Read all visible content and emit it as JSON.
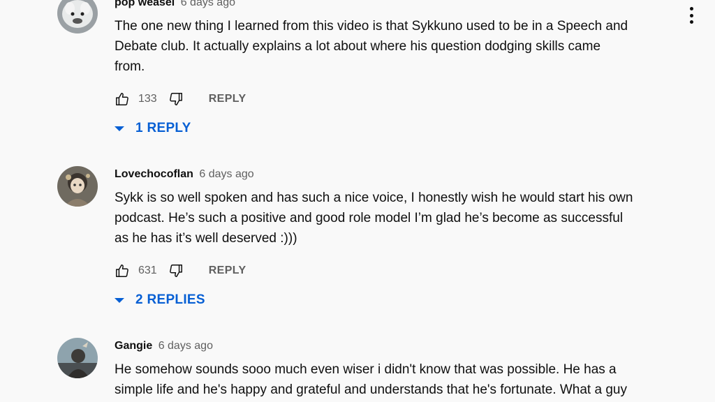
{
  "comments": [
    {
      "author": "pop weasel",
      "time": "6 days ago",
      "text_lines": [
        "The one new thing I learned from this video is that Sykkuno used to be in a Speech and",
        "Debate club. It actually explains a lot about where his question dodging skills came",
        "from."
      ],
      "likes": "133",
      "reply_label": "REPLY",
      "replies_label": "1 REPLY",
      "avatar_icon": "white-creature-avatar"
    },
    {
      "author": "Lovechocoflan",
      "time": "6 days ago",
      "text_lines": [
        "Sykk is so well spoken and has such a nice voice, I honestly wish he would start his own",
        "podcast. He’s such a positive and good role model I’m glad he’s become as successful",
        "as he has it’s well deserved :)))"
      ],
      "likes": "631",
      "reply_label": "REPLY",
      "replies_label": "2 REPLIES",
      "avatar_icon": "anime-character-avatar"
    },
    {
      "author": "Gangie",
      "time": "6 days ago",
      "text_lines": [
        "He somehow sounds sooo much even wiser i didn't know that was possible. He has a",
        "simple life and he's happy and grateful and understands that he's fortunate. What a guy"
      ],
      "avatar_icon": "character-portrait-avatar"
    }
  ],
  "icons": {
    "like": "thumbs-up-icon",
    "dislike": "thumbs-down-icon",
    "menu": "more-vert-icon",
    "expand": "caret-down-icon"
  },
  "colors": {
    "background": "#f9f9f9",
    "link_blue": "#065fd4",
    "secondary_text": "#606060"
  }
}
